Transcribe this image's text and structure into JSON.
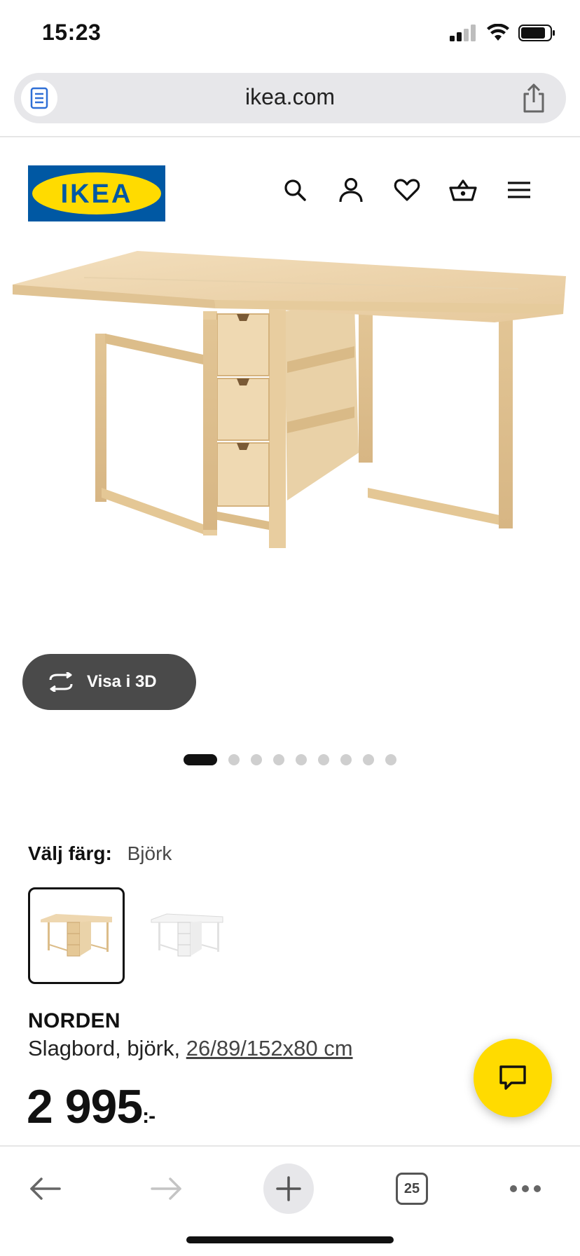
{
  "status_bar": {
    "time": "15:23",
    "icons": [
      "cellular-signal-icon",
      "wifi-icon",
      "battery-icon"
    ]
  },
  "browser": {
    "url": "ikea.com",
    "reader_icon": "reader-view-icon",
    "share_icon": "share-icon"
  },
  "header": {
    "logo_text": "IKEA",
    "icons": [
      "search-icon",
      "account-icon",
      "wishlist-heart-icon",
      "cart-basket-icon",
      "menu-icon"
    ],
    "colors": {
      "logo_blue": "#0058a3",
      "logo_yellow": "#ffdb00"
    }
  },
  "gallery": {
    "view3d_label": "Visa i 3D",
    "image_count": 9,
    "active_index": 0
  },
  "product": {
    "color_label": "Välj färg:",
    "color_value": "Björk",
    "swatches": [
      "björk",
      "vit"
    ],
    "name": "NORDEN",
    "desc_prefix": "Slagbord, björk, ",
    "dimensions": "26/89/152x80 cm",
    "price": "2 995",
    "price_suffix": ":-"
  },
  "chat": {
    "icon": "chat-icon",
    "color": "#ffdb00"
  },
  "toolbar": {
    "tab_count": "25",
    "icons": [
      "back-arrow-icon",
      "forward-arrow-icon",
      "new-tab-plus-icon",
      "tabs-icon",
      "more-icon"
    ]
  }
}
